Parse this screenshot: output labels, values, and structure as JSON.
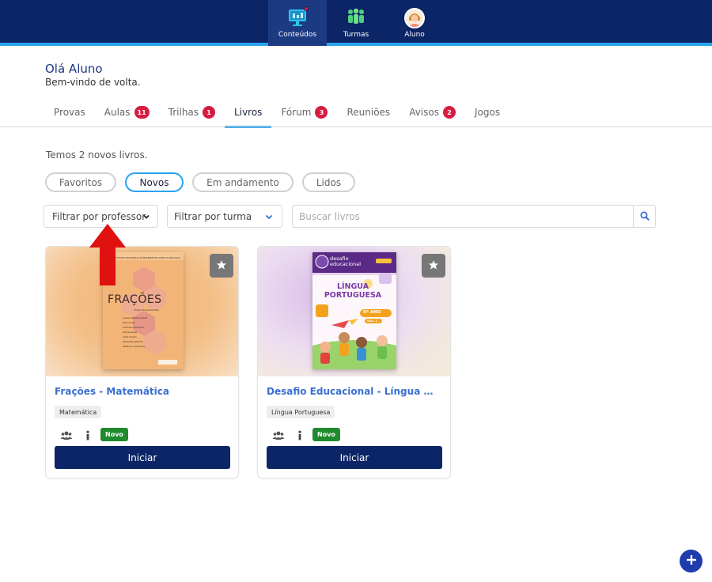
{
  "nav": {
    "items": [
      {
        "label": "Conteúdos",
        "icon": "monitor-icon"
      },
      {
        "label": "Turmas",
        "icon": "people-icon"
      },
      {
        "label": "Aluno",
        "icon": "avatar-icon"
      }
    ]
  },
  "greeting": {
    "title": "Olá Aluno",
    "subtitle": "Bem-vindo de volta."
  },
  "tabs": [
    {
      "label": "Provas",
      "badge": ""
    },
    {
      "label": "Aulas",
      "badge": "11"
    },
    {
      "label": "Trilhas",
      "badge": "1"
    },
    {
      "label": "Livros",
      "badge": ""
    },
    {
      "label": "Fórum",
      "badge": "3"
    },
    {
      "label": "Reuniões",
      "badge": ""
    },
    {
      "label": "Avisos",
      "badge": "2"
    },
    {
      "label": "Jogos",
      "badge": ""
    }
  ],
  "active_tab": "Livros",
  "new_books_text": "Temos 2 novos livros.",
  "chips": [
    {
      "label": "Favoritos"
    },
    {
      "label": "Novos"
    },
    {
      "label": "Em andamento"
    },
    {
      "label": "Lidos"
    }
  ],
  "active_chip": "Novos",
  "filters": {
    "professor": "Filtrar por professor",
    "turma": "Filtrar por turma",
    "search_placeholder": "Buscar livros"
  },
  "books": [
    {
      "title": "Frações - Matemática",
      "subject": "Matemática",
      "status": "Novo",
      "button": "Iniciar",
      "cover": {
        "header": "INSTITUTO NACIONAL DE MATEMÁTICA PURA E APLICADA",
        "title": "FRAÇÕES",
        "subtitle": "Ensino Fundamental",
        "authors": [
          "Cybele Castelani Rosett",
          "Fabio Simas",
          "Humberto Bortolossi",
          "Letícia Rangel",
          "Victor Giraldo",
          "Wanderley Rezende",
          "Walterson Guimarães"
        ]
      }
    },
    {
      "title": "Desafio Educacional - Língua Portuguesa",
      "subject": "Língua Portuguesa",
      "status": "Novo",
      "button": "Iniciar",
      "cover": {
        "brand": "desafio educacional",
        "title": "LÍNGUA PORTUGUESA",
        "grade": "6º ANO",
        "volume": "VOL. 1"
      }
    }
  ],
  "colors": {
    "topbar": "#0b2566",
    "accent": "#2aa3ef",
    "badge": "#d81b40",
    "novo": "#1f8a2e",
    "button": "#0b2566",
    "title_link": "#3a6fcf",
    "arrow": "#e01111"
  }
}
